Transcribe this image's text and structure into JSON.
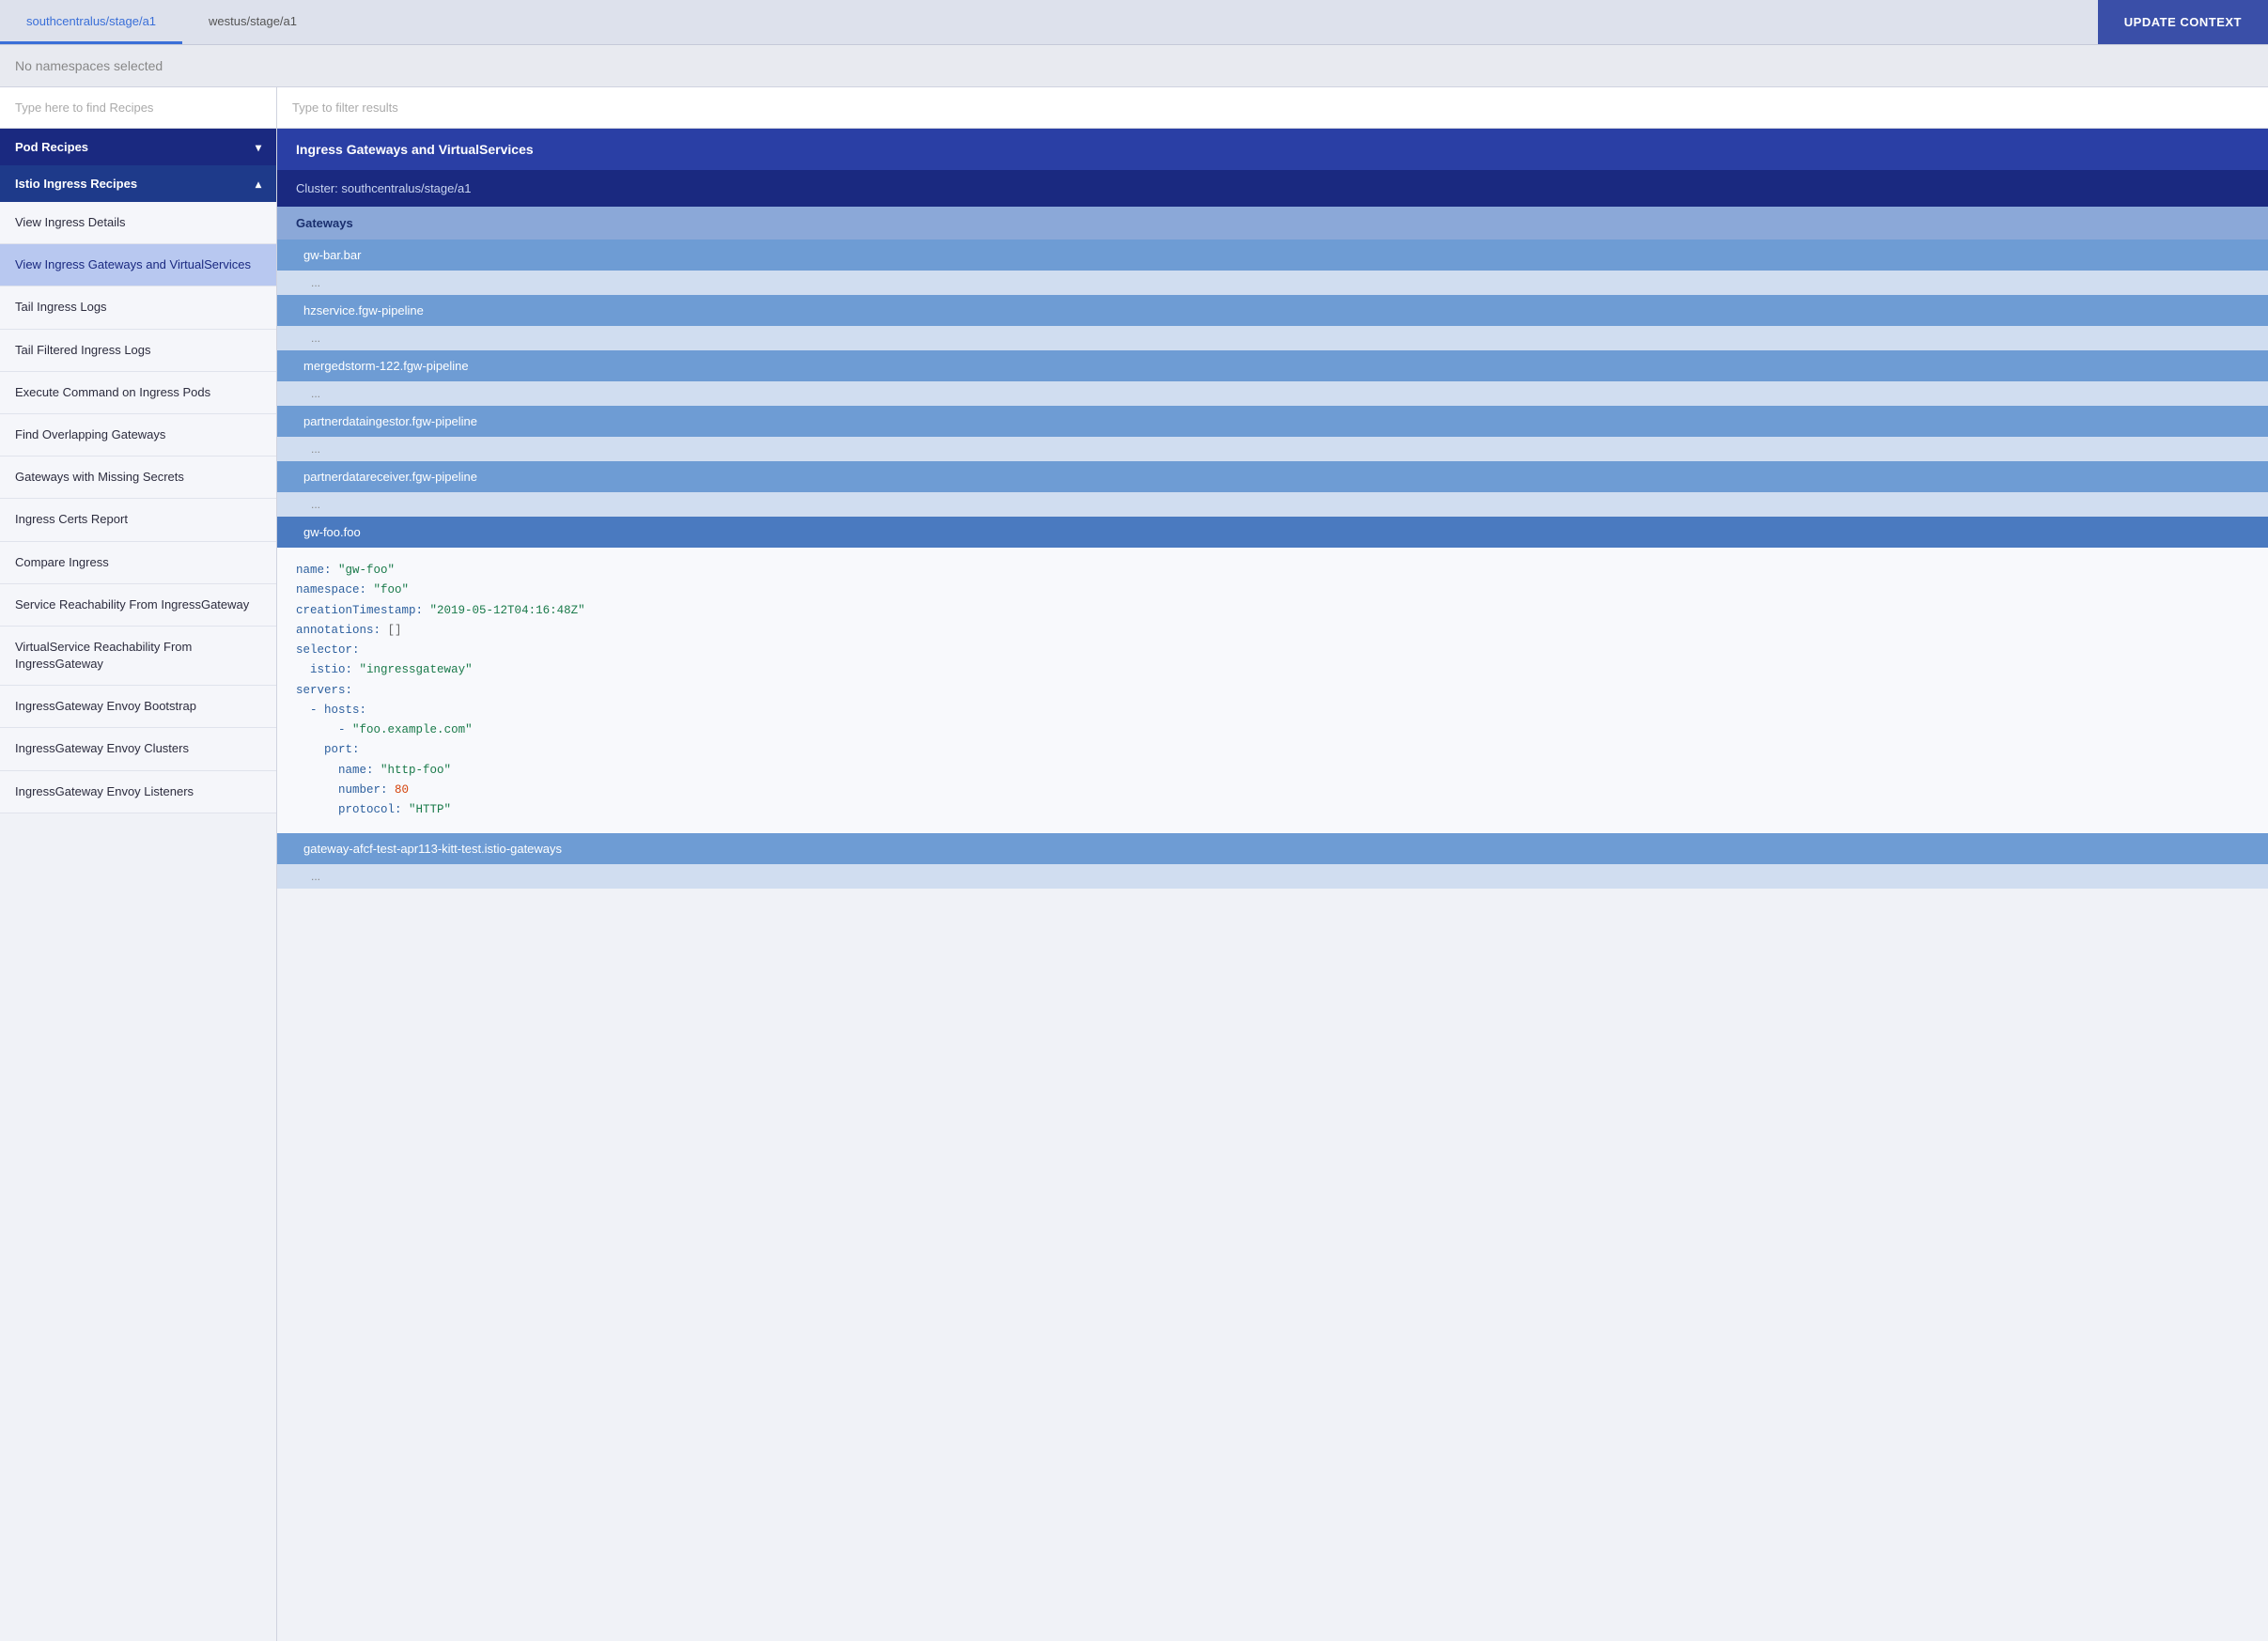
{
  "tabs": [
    {
      "id": "tab-south",
      "label": "southcentralus/stage/a1",
      "active": true
    },
    {
      "id": "tab-west",
      "label": "westus/stage/a1",
      "active": false
    }
  ],
  "updateContextButton": {
    "label": "UPDATE CONTEXT"
  },
  "namespaceBar": {
    "text": "No namespaces selected"
  },
  "leftPanel": {
    "searchPlaceholder": "Type here to find Recipes",
    "categories": [
      {
        "id": "pod-recipes",
        "label": "Pod Recipes",
        "collapsed": true,
        "chevron": "▾"
      },
      {
        "id": "istio-ingress-recipes",
        "label": "Istio Ingress Recipes",
        "collapsed": false,
        "chevron": "▴",
        "items": [
          {
            "id": "view-ingress-details",
            "label": "View Ingress Details",
            "active": false
          },
          {
            "id": "view-ingress-gateways",
            "label": "View Ingress Gateways and VirtualServices",
            "active": true
          },
          {
            "id": "tail-ingress-logs",
            "label": "Tail Ingress Logs",
            "active": false
          },
          {
            "id": "tail-filtered-ingress-logs",
            "label": "Tail Filtered Ingress Logs",
            "active": false
          },
          {
            "id": "execute-command",
            "label": "Execute Command on Ingress Pods",
            "active": false
          },
          {
            "id": "find-overlapping",
            "label": "Find Overlapping Gateways",
            "active": false
          },
          {
            "id": "gateways-missing-secrets",
            "label": "Gateways with Missing Secrets",
            "active": false
          },
          {
            "id": "ingress-certs-report",
            "label": "Ingress Certs Report",
            "active": false
          },
          {
            "id": "compare-ingress",
            "label": "Compare Ingress",
            "active": false
          },
          {
            "id": "service-reachability",
            "label": "Service Reachability From IngressGateway",
            "active": false
          },
          {
            "id": "virtualservice-reachability",
            "label": "VirtualService Reachability From IngressGateway",
            "active": false
          },
          {
            "id": "ingressgateway-envoy-bootstrap",
            "label": "IngressGateway Envoy Bootstrap",
            "active": false
          },
          {
            "id": "ingressgateway-envoy-clusters",
            "label": "IngressGateway Envoy Clusters",
            "active": false
          },
          {
            "id": "ingressgateway-envoy-listeners",
            "label": "IngressGateway Envoy Listeners",
            "active": false
          }
        ]
      }
    ]
  },
  "rightPanel": {
    "filterPlaceholder": "Type to filter results",
    "resultHeader": "Ingress Gateways and VirtualServices",
    "clusterLabel": "Cluster: southcentralus/stage/a1",
    "sectionLabel": "Gateways",
    "gateways": [
      {
        "id": "gw-bar-bar",
        "name": "gw-bar.bar",
        "hasDetails": true
      },
      {
        "id": "hzservice",
        "name": "hzservice.fgw-pipeline",
        "hasDetails": true
      },
      {
        "id": "mergedstorm",
        "name": "mergedstorm-122.fgw-pipeline",
        "hasDetails": true
      },
      {
        "id": "partnerdataingestor",
        "name": "partnerdataingestor.fgw-pipeline",
        "hasDetails": true
      },
      {
        "id": "partnerdatareceiver",
        "name": "partnerdatareceiver.fgw-pipeline",
        "hasDetails": true
      },
      {
        "id": "gw-foo-foo",
        "name": "gw-foo.foo",
        "hasDetails": true,
        "expanded": true
      }
    ],
    "expandedGateway": {
      "name": "gw-foo",
      "namespace": "foo",
      "creationTimestamp": "2019-05-12T04:16:48Z",
      "annotations": "[]",
      "selectorKey": "istio",
      "selectorValue": "ingressgateway",
      "servers": {
        "hostsItem": "foo.example.com",
        "portName": "http-foo",
        "portNumber": "80",
        "portProtocol": "HTTP"
      }
    },
    "bottomGateway": "gateway-afcf-test-apr113-kitt-test.istio-gateways"
  }
}
